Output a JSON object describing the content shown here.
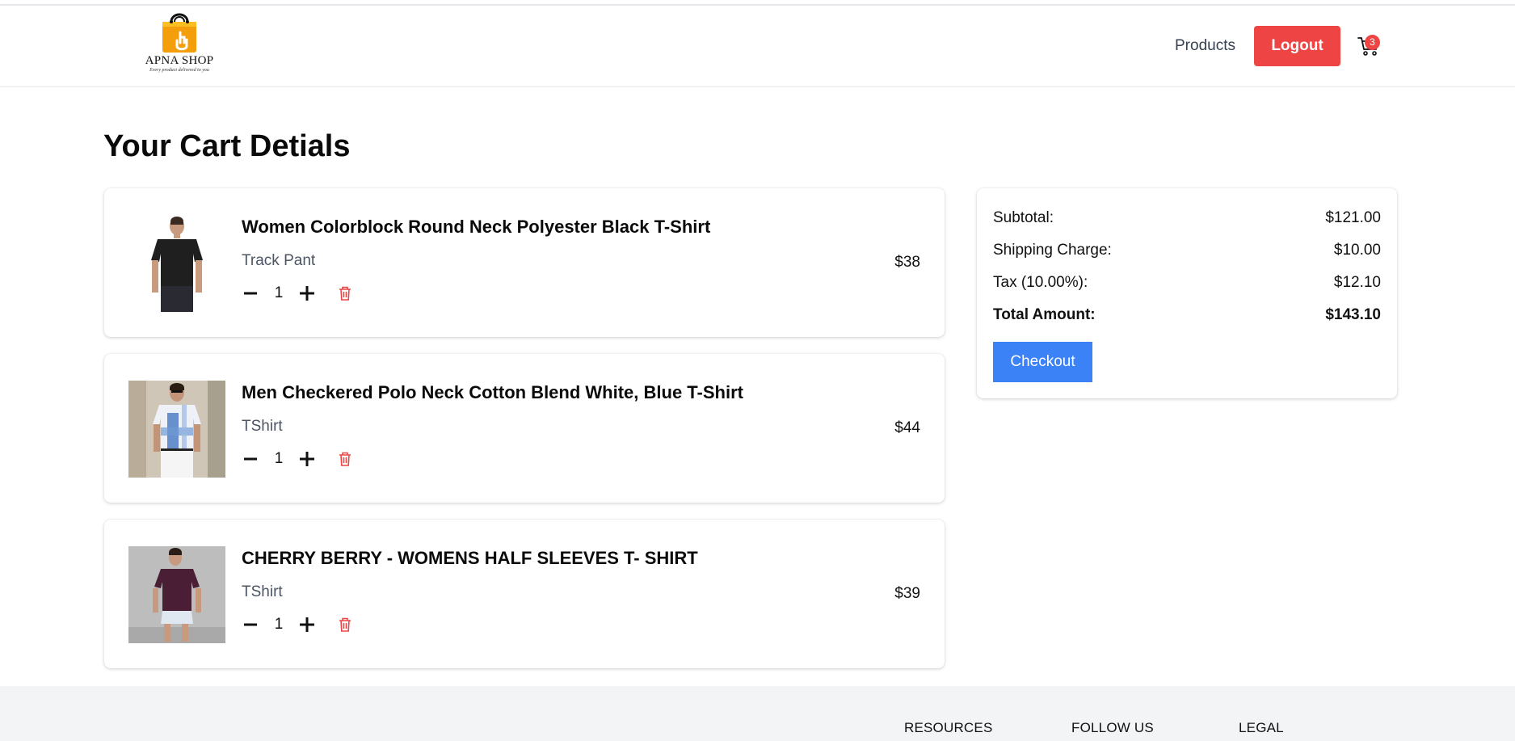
{
  "brand": {
    "name": "APNA SHOP",
    "tagline": "Every product delivered to you",
    "accent_color": "#f59e0b"
  },
  "nav": {
    "products_label": "Products",
    "logout_label": "Logout",
    "cart_icon": "shopping-cart-icon",
    "cart_count": "3"
  },
  "page": {
    "title": "Your Cart Detials"
  },
  "cart": {
    "items": [
      {
        "title": "Women Colorblock Round Neck Polyester Black T-Shirt",
        "category": "Track Pant",
        "quantity": "1",
        "price": "$38",
        "image": "woman-black-tshirt-photo"
      },
      {
        "title": "Men Checkered Polo Neck Cotton Blend White, Blue T-Shirt",
        "category": "TShirt",
        "quantity": "1",
        "price": "$44",
        "image": "man-checkered-polo-photo"
      },
      {
        "title": "CHERRY BERRY - WOMENS HALF SLEEVES T- SHIRT",
        "category": "TShirt",
        "quantity": "1",
        "price": "$39",
        "image": "woman-purple-tshirt-photo"
      }
    ]
  },
  "summary": {
    "subtotal_label": "Subtotal:",
    "subtotal_value": "$121.00",
    "shipping_label": "Shipping Charge:",
    "shipping_value": "$10.00",
    "tax_label": "Tax (10.00%):",
    "tax_value": "$12.10",
    "total_label": "Total Amount:",
    "total_value": "$143.10",
    "checkout_label": "Checkout"
  },
  "footer": {
    "resources": "RESOURCES",
    "follow_us": "FOLLOW US",
    "legal": "LEGAL"
  },
  "colors": {
    "logout": "#ef4444",
    "checkout": "#3b82f6",
    "delete": "#ef4444",
    "footer_bg": "#f3f4f6"
  }
}
